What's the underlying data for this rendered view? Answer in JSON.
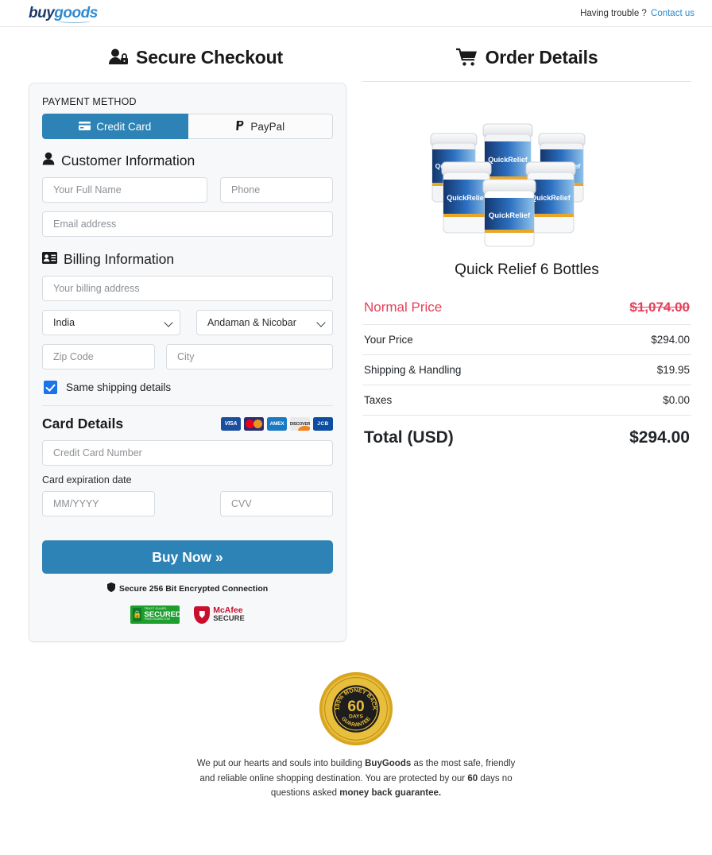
{
  "header": {
    "logo_buy": "buy",
    "logo_goods": "goods",
    "trouble_text": "Having trouble ?",
    "contact_link": "Contact us"
  },
  "checkout": {
    "title": "Secure Checkout",
    "payment_method_label": "PAYMENT METHOD",
    "tabs": [
      {
        "label": "Credit Card",
        "active": true
      },
      {
        "label": "PayPal",
        "active": false
      }
    ],
    "customer_section_title": "Customer Information",
    "fields": {
      "full_name_placeholder": "Your Full Name",
      "phone_placeholder": "Phone",
      "email_placeholder": "Email address",
      "billing_address_placeholder": "Your billing address",
      "zip_placeholder": "Zip Code",
      "city_placeholder": "City",
      "card_number_placeholder": "Credit Card Number",
      "expiry_placeholder": "MM/YYYY",
      "cvv_placeholder": "CVV"
    },
    "billing_section_title": "Billing Information",
    "country_value": "India",
    "state_value": "Andaman & Nicobar",
    "same_shipping_label": "Same shipping details",
    "same_shipping_checked": true,
    "card_details_title": "Card Details",
    "card_brands": [
      "VISA",
      "Mastercard",
      "AMEX",
      "DISCOVER",
      "JCB"
    ],
    "expiration_label": "Card expiration date",
    "buy_button_label": "Buy Now »",
    "secure_note": "Secure 256 Bit Encrypted Connection",
    "trust_badges": [
      {
        "name": "TRUST GUARD",
        "main": "SECURED",
        "sub": "TRUSTGUARD.COM"
      },
      {
        "name": "McAfee",
        "main": "SECURE"
      }
    ]
  },
  "order": {
    "title": "Order Details",
    "product_name": "Quick Relief 6 Bottles",
    "product_label_brand": "QuickRelief",
    "rows": [
      {
        "label": "Normal Price",
        "amount": "$1,074.00",
        "style": "normal"
      },
      {
        "label": "Your Price",
        "amount": "$294.00",
        "style": "plain"
      },
      {
        "label": "Shipping & Handling",
        "amount": "$19.95",
        "style": "plain"
      },
      {
        "label": "Taxes",
        "amount": "$0.00",
        "style": "plain"
      },
      {
        "label": "Total (USD)",
        "amount": "$294.00",
        "style": "total"
      }
    ]
  },
  "footer": {
    "seal": {
      "top_text": "100% MONEY BACK",
      "days": "60",
      "days_label": "DAYS",
      "bottom_text": "GUARANTEE"
    },
    "text_part1": "We put our hearts and souls into building ",
    "brand": "BuyGoods",
    "text_part2": " as the most safe, friendly and reliable online shopping destination. You are protected by our ",
    "days": "60",
    "text_part3": " days no questions asked ",
    "guarantee": "money back guarantee."
  },
  "colors": {
    "accent_blue": "#2d83b5",
    "link_blue": "#2e8bd0",
    "price_red": "#e4405a",
    "checkbox_blue": "#1a73e8",
    "panel_bg": "#f7f8fa"
  }
}
